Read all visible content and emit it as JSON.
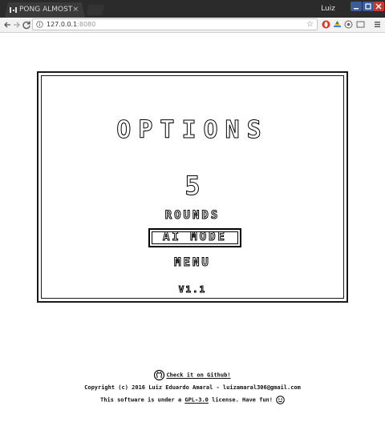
{
  "browser": {
    "tab_title": "PONG ALMOST",
    "tab_close_glyph": "×",
    "user_name": "Luiz",
    "url_host": "127.0.0.1",
    "url_port": ":8080",
    "icons": [
      "pong-favicon-icon",
      "back-arrow-icon",
      "forward-arrow-icon",
      "reload-icon",
      "info-icon",
      "star-icon",
      "extension-icons",
      "menu-icon"
    ],
    "colors": {
      "titlebar": "#2b2b2b",
      "min_max": "#3b5b9b",
      "close": "#c43b2e"
    }
  },
  "options": {
    "title": "OPTIONS",
    "rounds_value": "5",
    "rounds_label": "ROUNDS",
    "ai_mode_label": "AI MODE",
    "menu_label": "MENU",
    "version": "V1.1"
  },
  "footer": {
    "github_text": "Check it on Github!",
    "copyright": "Copyright (c) 2016 Luiz Eduardo Amaral - luizamaral306@gmail.com",
    "license_prefix": "This software is under a ",
    "license_name": "GPL-3.0",
    "license_suffix": " license. Have fun!"
  }
}
